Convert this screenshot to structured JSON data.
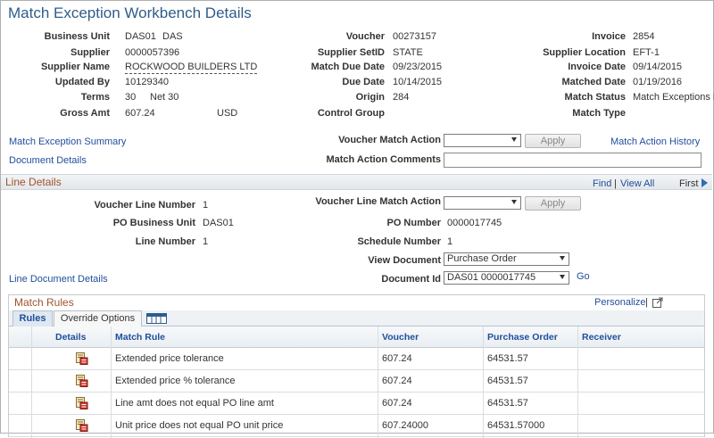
{
  "page": {
    "title": "Match Exception Workbench Details"
  },
  "header": {
    "business_unit": {
      "label": "Business Unit",
      "value": "DAS01",
      "desc": "DAS"
    },
    "supplier": {
      "label": "Supplier",
      "value": "0000057396"
    },
    "supplier_name": {
      "label": "Supplier Name",
      "value": "ROCKWOOD BUILDERS LTD"
    },
    "updated_by": {
      "label": "Updated By",
      "value": "10129340"
    },
    "terms": {
      "label": "Terms",
      "value": "30",
      "desc": "Net 30"
    },
    "gross_amt": {
      "label": "Gross Amt",
      "value": "607.24",
      "currency": "USD"
    },
    "voucher": {
      "label": "Voucher",
      "value": "00273157"
    },
    "supplier_setid": {
      "label": "Supplier SetID",
      "value": "STATE"
    },
    "match_due_date": {
      "label": "Match Due Date",
      "value": "09/23/2015"
    },
    "due_date": {
      "label": "Due Date",
      "value": "10/14/2015"
    },
    "origin": {
      "label": "Origin",
      "value": "284"
    },
    "control_group": {
      "label": "Control Group",
      "value": ""
    },
    "invoice": {
      "label": "Invoice",
      "value": "2854"
    },
    "supplier_location": {
      "label": "Supplier Location",
      "value": "EFT-1"
    },
    "invoice_date": {
      "label": "Invoice Date",
      "value": "09/14/2015"
    },
    "matched_date": {
      "label": "Matched Date",
      "value": "01/19/2016"
    },
    "match_status": {
      "label": "Match Status",
      "value": "Match Exceptions Exist"
    },
    "match_type": {
      "label": "Match Type",
      "value": ""
    }
  },
  "links": {
    "match_exception_summary": "Match Exception Summary",
    "document_details": "Document Details",
    "match_action_history": "Match Action History",
    "line_document_details": "Line Document Details"
  },
  "voucher_action": {
    "label": "Voucher Match Action",
    "value": "",
    "apply_label": "Apply",
    "comments_label": "Match Action Comments",
    "comments_value": ""
  },
  "line_details": {
    "title": "Line Details",
    "find": "Find",
    "separator": "|",
    "view_all": "View All",
    "first": "First",
    "voucher_line_number": {
      "label": "Voucher Line Number",
      "value": "1"
    },
    "po_business_unit": {
      "label": "PO Business Unit",
      "value": "DAS01"
    },
    "line_number": {
      "label": "Line Number",
      "value": "1"
    },
    "voucher_line_match_action": {
      "label": "Voucher Line Match Action",
      "value": ""
    },
    "apply_label": "Apply",
    "po_number": {
      "label": "PO Number",
      "value": "0000017745"
    },
    "schedule_number": {
      "label": "Schedule Number",
      "value": "1"
    },
    "view_document": {
      "label": "View Document",
      "value": "Purchase Order"
    },
    "document_id": {
      "label": "Document Id",
      "value": "DAS01 0000017745"
    },
    "go_label": "Go"
  },
  "match_rules": {
    "title": "Match Rules",
    "personalize": "Personalize",
    "separator": "|",
    "tabs": [
      {
        "label": "Rules",
        "active": true
      },
      {
        "label": "Override Options",
        "active": false
      }
    ],
    "columns": [
      "Details",
      "Match Rule",
      "Voucher",
      "Purchase Order",
      "Receiver"
    ],
    "rows": [
      {
        "rule": "Extended price tolerance",
        "voucher": "607.24",
        "po": "64531.57",
        "receiver": ""
      },
      {
        "rule": "Extended price % tolerance",
        "voucher": "607.24",
        "po": "64531.57",
        "receiver": ""
      },
      {
        "rule": "Line amt does not equal PO line amt",
        "voucher": "607.24",
        "po": "64531.57",
        "receiver": ""
      },
      {
        "rule": "Unit price does not equal PO unit price",
        "voucher": "607.24000",
        "po": "64531.57000",
        "receiver": ""
      }
    ]
  },
  "colors": {
    "title": "#2e5c8a",
    "link": "#1f4e9c",
    "section_title": "#a0522d"
  }
}
